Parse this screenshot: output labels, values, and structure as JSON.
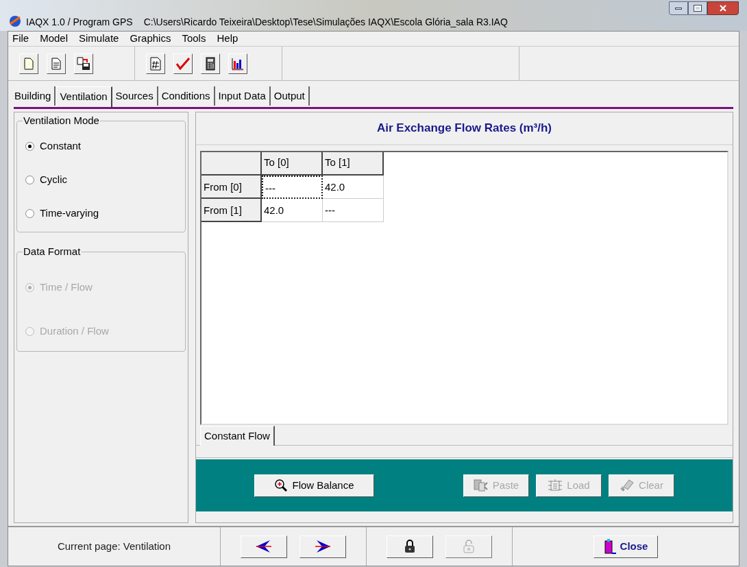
{
  "window": {
    "title": "IAQX 1.0 / Program GPS",
    "path": "C:\\Users\\Ricardo Teixeira\\Desktop\\Tese\\Simulações IAQX\\Escola Glória_sala R3.IAQ"
  },
  "menu": [
    "File",
    "Model",
    "Simulate",
    "Graphics",
    "Tools",
    "Help"
  ],
  "toolbar": [
    {
      "buttons": [
        {
          "kind": "new"
        },
        {
          "kind": "open"
        },
        {
          "kind": "save"
        }
      ]
    },
    {
      "buttons": [
        {
          "kind": "grid"
        },
        {
          "kind": "check"
        },
        {
          "kind": "calculator"
        },
        {
          "kind": "chart"
        }
      ]
    }
  ],
  "tabs": [
    {
      "label": "Building",
      "selected": false
    },
    {
      "label": "Ventilation",
      "selected": true
    },
    {
      "label": "Sources",
      "selected": false
    },
    {
      "label": "Conditions",
      "selected": false
    },
    {
      "label": "Input Data",
      "selected": false
    },
    {
      "label": "Output",
      "selected": false
    }
  ],
  "ventilation_mode": {
    "legend": "Ventilation Mode",
    "disabled": false,
    "options": [
      {
        "label": "Constant",
        "selected": true
      },
      {
        "label": "Cyclic",
        "selected": false
      },
      {
        "label": "Time-varying",
        "selected": false
      }
    ]
  },
  "data_format": {
    "legend": "Data Format",
    "disabled": true,
    "options": [
      {
        "label": "Time / Flow",
        "selected": true
      },
      {
        "label": "Duration / Flow",
        "selected": false
      }
    ]
  },
  "table": {
    "title": "Air Exchange Flow Rates (m³/h)",
    "columns": [
      "To [0]",
      "To [1]"
    ],
    "rows": [
      {
        "header": "From [0]",
        "cells": [
          {
            "value": "---",
            "focused": true
          },
          {
            "value": "42.0",
            "focused": false
          }
        ]
      },
      {
        "header": "From [1]",
        "cells": [
          {
            "value": "42.0",
            "focused": false
          },
          {
            "value": "---",
            "focused": false
          }
        ]
      }
    ]
  },
  "subtabs": [
    {
      "label": "Constant Flow",
      "selected": true
    }
  ],
  "actions": [
    {
      "label": "Flow Balance",
      "kind": "zoom",
      "disabled": false
    },
    {
      "label": "Paste",
      "kind": "paste",
      "disabled": true
    },
    {
      "label": "Load",
      "kind": "load",
      "disabled": true
    },
    {
      "label": "Clear",
      "kind": "clear",
      "disabled": true
    }
  ],
  "status": {
    "text": "Current page: Ventilation"
  },
  "nav": [
    {
      "kind": "back",
      "disabled": false
    },
    {
      "kind": "forward",
      "disabled": false
    },
    {
      "kind": "lock",
      "disabled": false
    },
    {
      "kind": "unlock",
      "disabled": true
    }
  ],
  "close_button": {
    "label": "Close"
  }
}
